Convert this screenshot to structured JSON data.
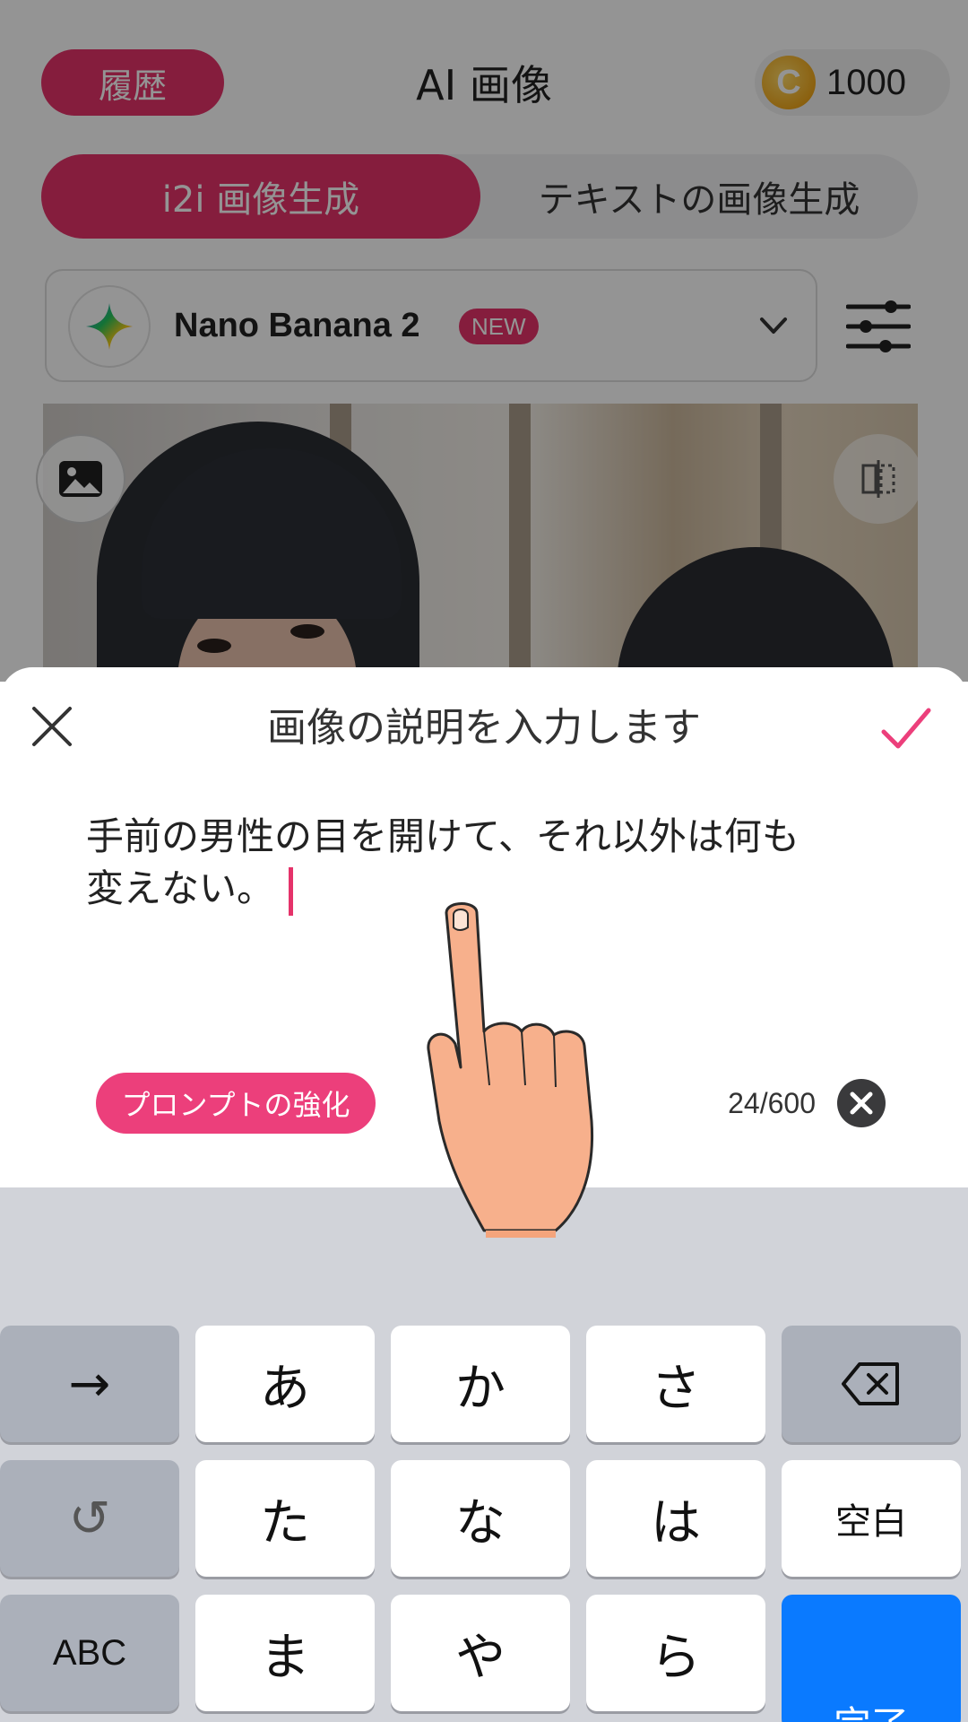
{
  "header": {
    "history_label": "履歴",
    "title": "AI 画像",
    "coin_symbol": "C",
    "coin_count": "1000"
  },
  "mode_tabs": [
    {
      "label": "i2i 画像生成",
      "active": true
    },
    {
      "label": "テキストの画像生成",
      "active": false
    }
  ],
  "model": {
    "name": "Nano Banana 2",
    "badge": "NEW"
  },
  "sheet": {
    "title": "画像の説明を入力します",
    "prompt_line1": "手前の男性の目を開けて、それ以外は何も",
    "prompt_line2": "変えない。",
    "enhance_label": "プロンプトの強化",
    "counter": "24/600"
  },
  "keyboard": {
    "row1": [
      "→",
      "あ",
      "か",
      "さ",
      "⌫"
    ],
    "row2": [
      "↺",
      "た",
      "な",
      "は",
      "空白"
    ],
    "row3": [
      "ABC",
      "ま",
      "や",
      "ら",
      "完了"
    ]
  },
  "colors": {
    "accent": "#e5336a",
    "enhance": "#ec3f7b",
    "done_key": "#0a7aff",
    "keyboard_bg": "#d1d3d9"
  }
}
